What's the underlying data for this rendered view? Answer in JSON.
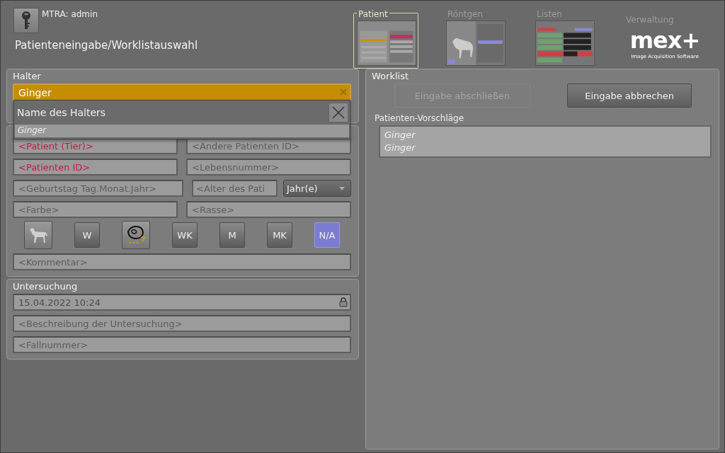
{
  "header": {
    "user": "MTRA: admin",
    "title": "Patienteneingabe/Worklistauswahl"
  },
  "nav_tabs": [
    {
      "label": "Patient",
      "selected": true,
      "kind": "form"
    },
    {
      "label": "Röntgen",
      "selected": false,
      "kind": "xray"
    },
    {
      "label": "Listen",
      "selected": false,
      "kind": "list"
    },
    {
      "label": "Verwaltung",
      "selected": false,
      "kind": "logo"
    }
  ],
  "logo": {
    "text": "mex+",
    "tagline": "Image Acquisition Software"
  },
  "owner": {
    "title": "Halter",
    "value": "Ginger",
    "focused": true,
    "dropdown": {
      "header": "Name des Halters",
      "items": [
        "Ginger"
      ]
    }
  },
  "patient": {
    "fields": [
      {
        "placeholder": "<Patient (Tier)>",
        "required": true
      },
      {
        "placeholder": "<Andere Patienten ID>",
        "required": false
      },
      {
        "placeholder": "<Patienten ID>",
        "required": true
      },
      {
        "placeholder": "<Lebensnummer>",
        "required": false
      },
      {
        "placeholder": "<Geburtstag Tag.Monat.Jahr>",
        "required": false
      },
      {
        "placeholder": "<Alter des Pati",
        "required": false,
        "unit": "Jahr(e)"
      },
      {
        "placeholder": "<Farbe>",
        "required": false
      },
      {
        "placeholder": "<Rasse>",
        "required": false
      }
    ],
    "sex_buttons": [
      {
        "kind": "dog",
        "selected": false
      },
      {
        "kind": "text",
        "label": "W",
        "selected": false
      },
      {
        "kind": "unknown",
        "selected": false
      },
      {
        "kind": "text",
        "label": "WK",
        "selected": false
      },
      {
        "kind": "text",
        "label": "M",
        "selected": false
      },
      {
        "kind": "text",
        "label": "MK",
        "selected": false
      },
      {
        "kind": "text",
        "label": "N/A",
        "selected": true
      }
    ],
    "comment": {
      "placeholder": "<Kommentar>"
    }
  },
  "examination": {
    "title": "Untersuchung",
    "date": {
      "value": "15.04.2022 10:24",
      "locked": true
    },
    "fields": [
      {
        "placeholder": "<Beschreibung der Untersuchung>"
      },
      {
        "placeholder": "<Fallnummer>"
      }
    ]
  },
  "worklist": {
    "title": "Worklist",
    "buttons": [
      {
        "label": "Eingabe abschließen",
        "disabled": true
      },
      {
        "label": "Eingabe abbrechen",
        "disabled": false
      }
    ],
    "suggestions": {
      "title": "Patienten-Vorschläge",
      "items": [
        "Ginger",
        "Ginger"
      ]
    }
  }
}
